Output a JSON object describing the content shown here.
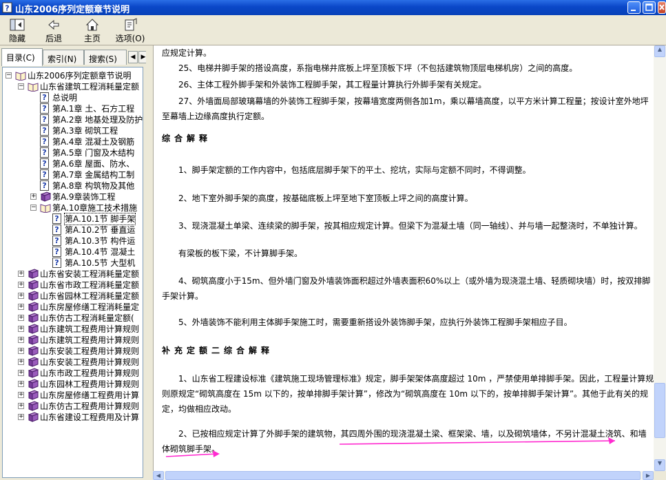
{
  "window": {
    "title": "山东2006序列定额章节说明"
  },
  "toolbar": {
    "buttons": [
      {
        "label": "隐藏"
      },
      {
        "label": "后退"
      },
      {
        "label": "主页"
      },
      {
        "label": "选项(O)"
      }
    ]
  },
  "nav_tabs": [
    {
      "label": "目录(C)",
      "active": true
    },
    {
      "label": "索引(N)",
      "active": false
    },
    {
      "label": "搜索(S)",
      "active": false
    }
  ],
  "tree": [
    {
      "label": "山东2006序列定额章节说明",
      "level": 0,
      "icon": "book-open-icon",
      "expander": "-"
    },
    {
      "label": "山东省建筑工程消耗量定额",
      "level": 1,
      "icon": "book-open-icon",
      "expander": "-"
    },
    {
      "label": "总说明",
      "level": 2,
      "icon": "help-page-icon",
      "expander": ""
    },
    {
      "label": "第A.1章 土、石方工程",
      "level": 2,
      "icon": "help-page-icon",
      "expander": ""
    },
    {
      "label": "第A.2章 地基处理及防护",
      "level": 2,
      "icon": "help-page-icon",
      "expander": ""
    },
    {
      "label": "第A.3章 砌筑工程",
      "level": 2,
      "icon": "help-page-icon",
      "expander": ""
    },
    {
      "label": "第A.4章 混凝土及钢筋",
      "level": 2,
      "icon": "help-page-icon",
      "expander": ""
    },
    {
      "label": "第A.5章 门窗及木结构",
      "level": 2,
      "icon": "help-page-icon",
      "expander": ""
    },
    {
      "label": "第A.6章 屋面、防水、",
      "level": 2,
      "icon": "help-page-icon",
      "expander": ""
    },
    {
      "label": "第A.7章 金属结构工制",
      "level": 2,
      "icon": "help-page-icon",
      "expander": ""
    },
    {
      "label": "第A.8章 构筑物及其他",
      "level": 2,
      "icon": "help-page-icon",
      "expander": ""
    },
    {
      "label": "第A.9章装饰工程",
      "level": 2,
      "icon": "book-closed-icon",
      "expander": "+"
    },
    {
      "label": "第A.10章施工技术措施",
      "level": 2,
      "icon": "book-open-icon",
      "expander": "-"
    },
    {
      "label": "第A.10.1节 脚手架",
      "level": 3,
      "icon": "help-page-icon",
      "expander": "",
      "selected": true
    },
    {
      "label": "第A.10.2节 垂直运",
      "level": 3,
      "icon": "help-page-icon",
      "expander": ""
    },
    {
      "label": "第A.10.3节 构件运",
      "level": 3,
      "icon": "help-page-icon",
      "expander": ""
    },
    {
      "label": "第A.10.4节 混凝土",
      "level": 3,
      "icon": "help-page-icon",
      "expander": ""
    },
    {
      "label": "第A.10.5节 大型机",
      "level": 3,
      "icon": "help-page-icon",
      "expander": ""
    },
    {
      "label": "山东省安装工程消耗量定额",
      "level": 1,
      "icon": "book-closed-icon",
      "expander": "+"
    },
    {
      "label": "山东省市政工程消耗量定额",
      "level": 1,
      "icon": "book-closed-icon",
      "expander": "+"
    },
    {
      "label": "山东省园林工程消耗量定额",
      "level": 1,
      "icon": "book-closed-icon",
      "expander": "+"
    },
    {
      "label": "山东房屋修缮工程消耗量定",
      "level": 1,
      "icon": "book-closed-icon",
      "expander": "+"
    },
    {
      "label": "山东仿古工程消耗量定额(",
      "level": 1,
      "icon": "book-closed-icon",
      "expander": "+"
    },
    {
      "label": "山东建筑工程费用计算规则",
      "level": 1,
      "icon": "book-closed-icon",
      "expander": "+"
    },
    {
      "label": "山东建筑工程费用计算规则",
      "level": 1,
      "icon": "book-closed-icon",
      "expander": "+"
    },
    {
      "label": "山东安装工程费用计算规则",
      "level": 1,
      "icon": "book-closed-icon",
      "expander": "+"
    },
    {
      "label": "山东安装工程费用计算规则",
      "level": 1,
      "icon": "book-closed-icon",
      "expander": "+"
    },
    {
      "label": "山东市政工程费用计算规则",
      "level": 1,
      "icon": "book-closed-icon",
      "expander": "+"
    },
    {
      "label": "山东园林工程费用计算规则",
      "level": 1,
      "icon": "book-closed-icon",
      "expander": "+"
    },
    {
      "label": "山东房屋修缮工程费用计算",
      "level": 1,
      "icon": "book-closed-icon",
      "expander": "+"
    },
    {
      "label": "山东仿古工程费用计算规则",
      "level": 1,
      "icon": "book-closed-icon",
      "expander": "+"
    },
    {
      "label": "山东省建设工程费用及计算",
      "level": 1,
      "icon": "book-closed-icon",
      "expander": "+"
    }
  ],
  "content": {
    "paragraphs": [
      {
        "text": "应规定计算。",
        "heading": false,
        "top": 0
      },
      {
        "text": "　　25、电梯井脚手架的搭设高度，系指电梯井底板上坪至顶板下坪（不包括建筑物顶层电梯机房）之间的高度。",
        "heading": false
      },
      {
        "text": "　　26、主体工程外脚手架和外装饰工程脚手架，其工程量计算执行外脚手架有关规定。",
        "heading": false
      },
      {
        "text": "　　27、外墙面局部玻璃幕墙的外装饰工程脚手架，按幕墙宽度两侧各加1m，乘以幕墙高度，以平方米计算工程量；按设计室外地坪至幕墙上边缘高度执行定额。",
        "heading": false
      },
      {
        "text": "综合解释",
        "heading": true
      },
      {
        "text": "　　1、脚手架定额的工作内容中，包括底层脚手架下的平土、挖坑，实际与定额不同时，不得调整。",
        "heading": false
      },
      {
        "text": "　　2、地下室外脚手架的高度，按基础底板上坪至地下室顶板上坪之间的高度计算。",
        "heading": false
      },
      {
        "text": "　　3、现浇混凝土单梁、连续梁的脚手架，按其相应规定计算。但梁下为混凝土墙（同一轴线）、并与墙一起整浇时，不单独计算。",
        "heading": false
      },
      {
        "text": "　　有梁板的板下梁，不计算脚手架。",
        "heading": false
      },
      {
        "text": "　　4、砌筑高度小于15m、但外墙门窗及外墙装饰面积超过外墙表面积60%以上（或外墙为现浇混土墙、轻质砌块墙）时，按双排脚手架计算。",
        "heading": false
      },
      {
        "text": "　　5、外墙装饰不能利用主体脚手架施工时，需要重新搭设外装饰脚手架，应执行外装饰工程脚手架相应子目。",
        "heading": false
      },
      {
        "text": "补充定额二综合解释",
        "heading": true
      },
      {
        "text": "　　1、山东省工程建设标准《建筑施工现场管理标准》规定，脚手架架体高度超过 10m ，严禁使用单排脚手架。因此，工程量计算规则原规定“砌筑高度在 15m 以下的，按单排脚手架计算”，修改为“砌筑高度在 10m 以下的，按单排脚手架计算”。其他于此有关的规定，均做相应改动。",
        "heading": false
      },
      {
        "text": "　　2、已按相应规定计算了外脚手架的建筑物，其四周外围的现浇混凝土梁、框架梁、墙，以及砌筑墙体，不另计混凝土浇筑、和墙体砌筑脚手架。",
        "heading": false
      }
    ]
  },
  "colors": {
    "titlebar": "#0a47c8",
    "annotation_arrow": "#ff2bd0"
  }
}
